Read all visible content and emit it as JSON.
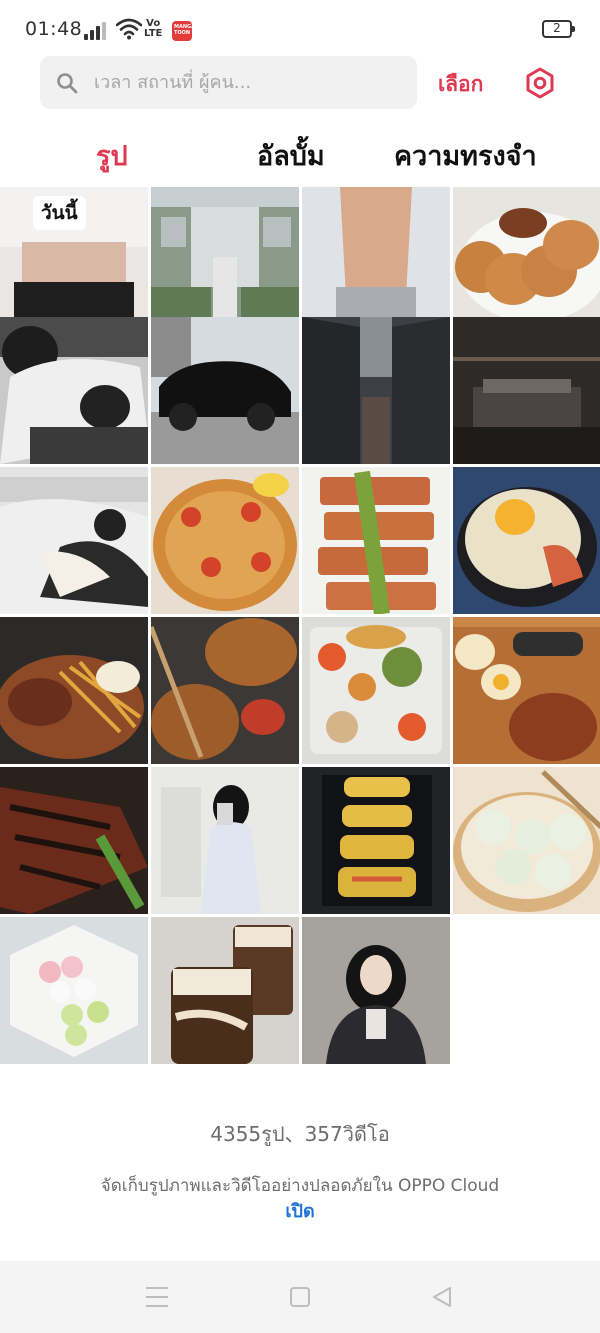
{
  "status_bar": {
    "time": "01:48",
    "network": "Vo\nLTE",
    "app_notification_label": "MANGA TOON",
    "battery": "2"
  },
  "search": {
    "placeholder": "เวลา สถานที่ ผู้คน..."
  },
  "header": {
    "select_label": "เลือก"
  },
  "tabs": [
    {
      "label": "รูป",
      "active": true
    },
    {
      "label": "อัลบั้ม",
      "active": false
    },
    {
      "label": "ความทรงจำ",
      "active": false
    }
  ],
  "grid": {
    "today_label": "วันนี้",
    "photos": [
      {
        "subject": "torso-white-shirt"
      },
      {
        "subject": "aerial-villa"
      },
      {
        "subject": "shirtless-torso"
      },
      {
        "subject": "dorayaki-pancakes"
      },
      {
        "subject": "sleeping-couple"
      },
      {
        "subject": "black-suv"
      },
      {
        "subject": "dark-buildings"
      },
      {
        "subject": "dark-bedroom"
      },
      {
        "subject": "manga-couple"
      },
      {
        "subject": "shrimp-spaghetti"
      },
      {
        "subject": "salmon-fillets"
      },
      {
        "subject": "fried-egg-rice"
      },
      {
        "subject": "steak-fries"
      },
      {
        "subject": "fried-rice-bowls"
      },
      {
        "subject": "dipping-sauces-platter"
      },
      {
        "subject": "fried-chicken-box"
      },
      {
        "subject": "grilled-meat"
      },
      {
        "subject": "girl-mirror-selfie"
      },
      {
        "subject": "omelette-rolls"
      },
      {
        "subject": "dumplings-steamer"
      },
      {
        "subject": "dango-plate"
      },
      {
        "subject": "coffee-jelly-drinks"
      },
      {
        "subject": "girl-brick-wall"
      }
    ]
  },
  "footer": {
    "count": "4355รูป、357วิดีโอ",
    "cloud_message": "จัดเก็บรูปภาพและวิดีโออย่างปลอดภัยใน OPPO Cloud",
    "cloud_link": "เปิด"
  },
  "colors": {
    "accent": "#e03a52",
    "link": "#1f73d8",
    "muted_text": "#6d6d6d"
  }
}
